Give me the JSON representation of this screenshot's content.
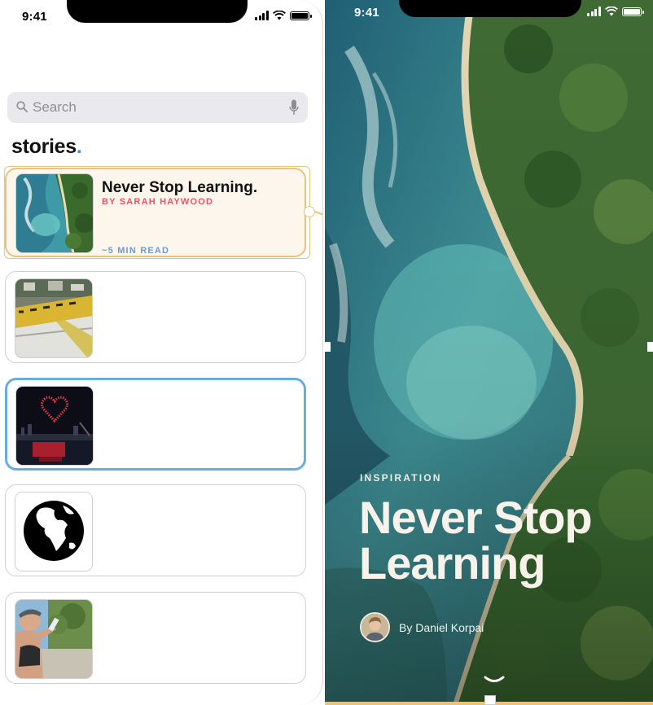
{
  "left_screen": {
    "status_time": "9:41",
    "search": {
      "placeholder": "Search"
    },
    "section_title": "stories",
    "section_title_dot": ".",
    "stories": [
      {
        "title": "Never Stop Learning.",
        "author": "BY SARAH HAYWOOD",
        "read_time": "~5 MIN READ",
        "thumb": "beach-aerial-thumbnail"
      },
      {
        "title": "",
        "thumb": "city-aerial-thumbnail"
      },
      {
        "title": "",
        "thumb": "night-drone-heart-thumbnail"
      },
      {
        "title": "",
        "thumb": "globe-icon-thumbnail"
      },
      {
        "title": "",
        "thumb": "runner-drinking-thumbnail"
      }
    ]
  },
  "right_screen": {
    "status_time": "9:41",
    "kicker": "INSPIRATION",
    "title_line1": "Never Stop",
    "title_line2": "Learning",
    "byline": "By Daniel Korpai"
  },
  "colors": {
    "featured_border": "#e9c37a",
    "featured_bg": "#fdf6ec",
    "selected_border": "#66aee0",
    "author_pink": "#e8556b",
    "read_blue": "#6b9bd1",
    "title_dot_blue": "#4a90e2"
  }
}
